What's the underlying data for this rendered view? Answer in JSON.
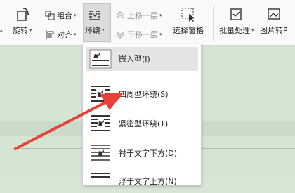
{
  "ribbon": {
    "rotate_label": "旋转",
    "group_label": "组合",
    "align_label": "对齐",
    "wrap_label": "环绕",
    "bring_forward_label": "上移一层",
    "send_backward_label": "下移一层",
    "selection_pane_label": "选择窗格",
    "batch_label": "批量处理",
    "img_convert_label": "图片转P"
  },
  "wrap_menu": {
    "items": [
      {
        "label": "嵌入型(I)"
      },
      {
        "label": "四周型环绕(S)"
      },
      {
        "label": "紧密型环绕(T)"
      },
      {
        "label": "衬于文字下方(D)"
      },
      {
        "label": "浮于文字上方(N)"
      }
    ]
  },
  "colors": {
    "annotation_arrow": "#e8413a",
    "document_bg": "#d5e5d4",
    "menu_selected": "#e4e4e4"
  }
}
